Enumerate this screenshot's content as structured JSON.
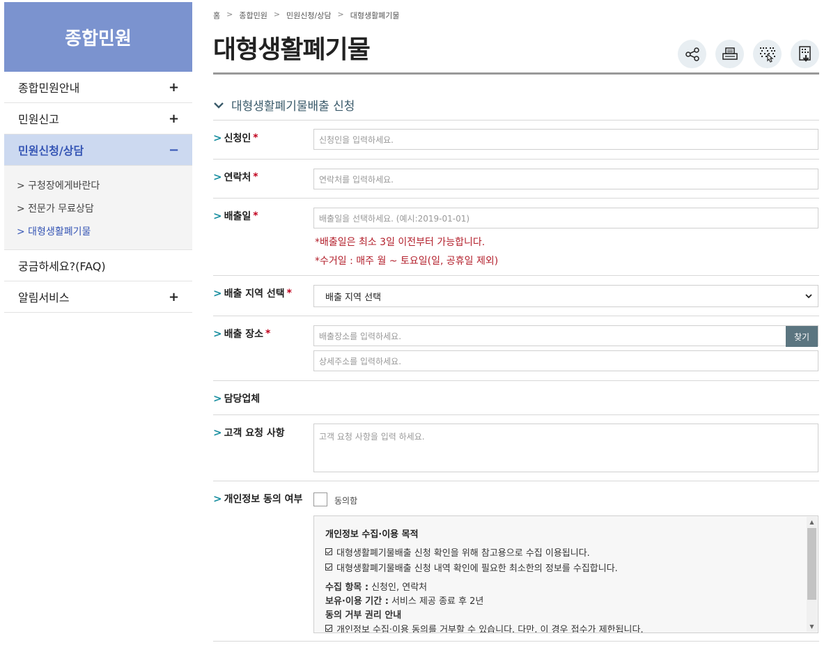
{
  "sidebar": {
    "title": "종합민원",
    "items": [
      {
        "label": "종합민원안내",
        "toggle": "+"
      },
      {
        "label": "민원신고",
        "toggle": "+"
      },
      {
        "label": "민원신청/상담",
        "toggle": "−"
      },
      {
        "label": "궁금하세요?(FAQ)",
        "toggle": ""
      },
      {
        "label": "알림서비스",
        "toggle": "+"
      }
    ],
    "sub_items": [
      {
        "label": "> 구청장에게바란다"
      },
      {
        "label": "> 전문가 무료상담"
      },
      {
        "label": "> 대형생활폐기물"
      }
    ]
  },
  "breadcrumb": [
    "홈",
    "종합민원",
    "민원신청/상담",
    "대형생활폐기물"
  ],
  "breadcrumb_sep": ">",
  "page_title": "대형생활폐기물",
  "toolbar": {
    "icons": [
      "share-icon",
      "print-icon",
      "qr-icon",
      "download-icon"
    ]
  },
  "section": {
    "toggle_icon": "chevron-down-icon",
    "title": "대형생활폐기물배출 신청"
  },
  "form": {
    "arrow": ">",
    "required_mark": "*",
    "applicant": {
      "label": "신청인",
      "placeholder": "신청인을 입력하세요."
    },
    "contact": {
      "label": "연락처",
      "placeholder": "연락처를 입력하세요."
    },
    "date": {
      "label": "배출일",
      "placeholder": "배출일을 선택하세요. (예시:2019-01-01)",
      "note1": "*배출일은 최소 3일 이전부터 가능합니다.",
      "note2": "*수거일 : 매주 월 ~ 토요일(일, 공휴일 제외)"
    },
    "region": {
      "label": "배출 지역 선택",
      "selected": "배출 지역 선택",
      "chevron": "⌄"
    },
    "place": {
      "label": "배출 장소",
      "placeholder": "배출장소를 입력하세요.",
      "find_label": "찾기",
      "detail_placeholder": "상세주소를 입력하세요."
    },
    "company": {
      "label": "담당업체"
    },
    "request": {
      "label": "고객 요청 사항",
      "placeholder": "고객 요청 사항을 입력 하세요."
    },
    "privacy": {
      "label": "개인정보 동의 여부",
      "agree_label": "동의함",
      "purpose_title": "개인정보 수집·이용 목적",
      "purpose_lines": [
        "대형생활폐기물배출 신청 확인을 위해 참고용으로 수집 이용됩니다.",
        "대형생활폐기물배출 신청 내역 확인에 필요한 최소한의 정보를 수집합니다."
      ],
      "items_key": "수집 항목 :",
      "items_value": "신청인, 연락처",
      "period_key": "보유·이용 기간 :",
      "period_value": "서비스 제공 종료 후 2년",
      "refuse_title": "동의 거부 권리 안내",
      "refuse_line": "개인정보 수집·이용 동의를 거부할 수 있습니다. 다만, 이 경우 접수가 제한됩니다."
    }
  }
}
